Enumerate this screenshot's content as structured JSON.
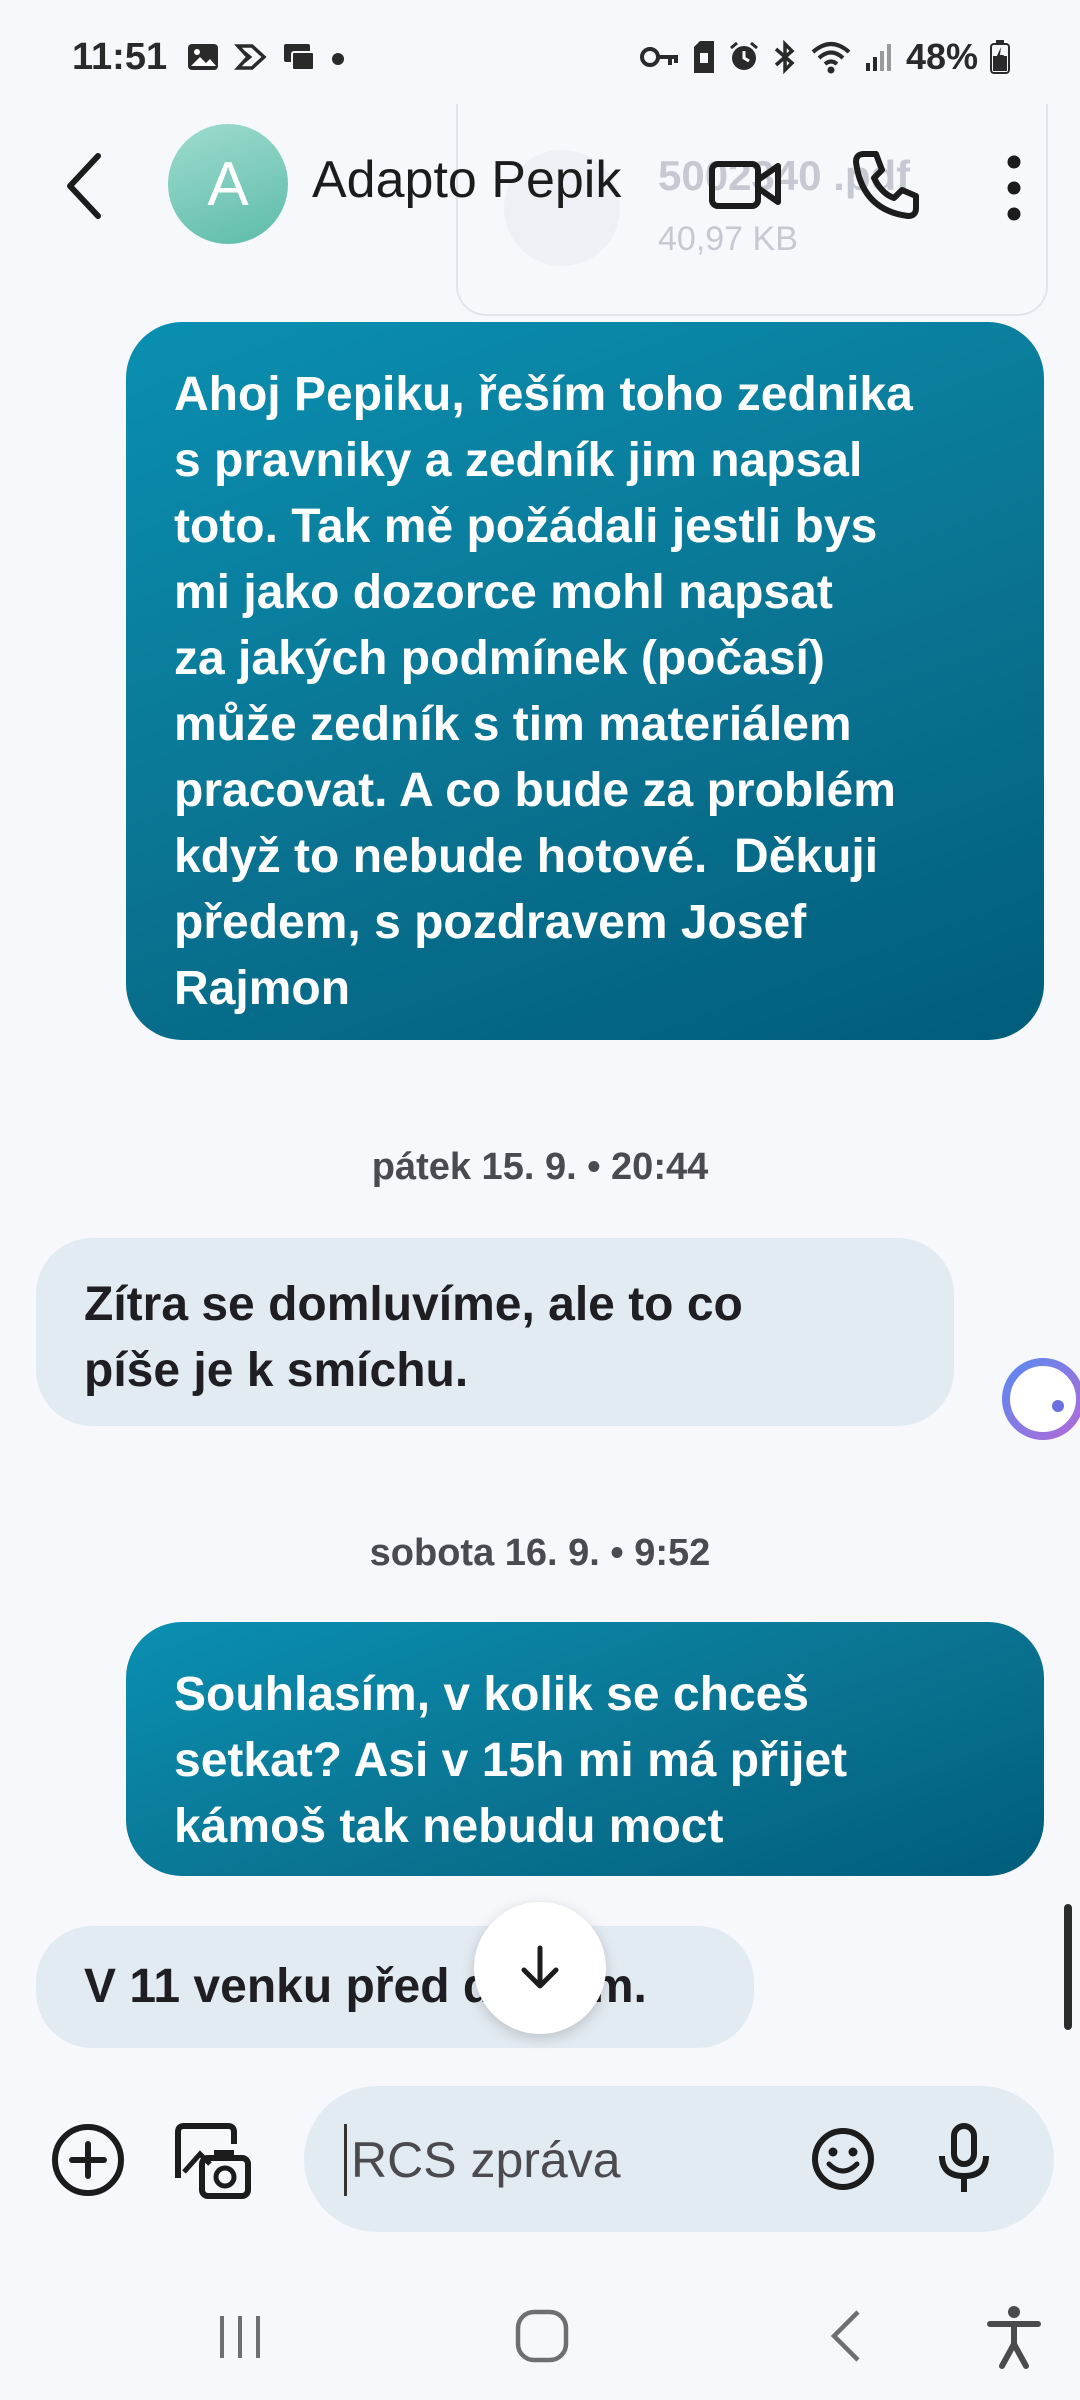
{
  "status_bar": {
    "time": "11:51",
    "battery": "48%",
    "left_icons": [
      "image-notification-icon",
      "app-notification-icon",
      "multi-window-icon",
      "dot-icon"
    ],
    "right_icons": [
      "key-icon",
      "sim-icon",
      "alarm-icon",
      "bluetooth-icon",
      "wifi-icon",
      "signal-icon",
      "battery-icon"
    ]
  },
  "header": {
    "avatar_letter": "A",
    "contact_name": "Adapto Pepik",
    "avatar_color": "#7cccbc"
  },
  "attachment": {
    "file_name": "5002340 .pdf",
    "file_size": "40,97 KB"
  },
  "messages": [
    {
      "direction": "out",
      "lines": [
        "Ahoj Pepiku, řeším toho zednika",
        "s pravniky a zedník jim napsal",
        "toto. Tak mě požádali jestli bys",
        "mi jako dozorce mohl napsat",
        "za jakých podmínek (počasí)",
        "může zedník s tim materiálem",
        "pracovat. A co bude za problém",
        "když to nebude hotové.  Děkuji",
        "předem, s pozdravem Josef",
        "Rajmon"
      ]
    },
    {
      "date_separator": "pátek 15. 9. • 20:44"
    },
    {
      "direction": "in",
      "lines": [
        "Zítra se domluvíme, ale to co",
        "píše je k smíchu."
      ]
    },
    {
      "date_separator": "sobota 16. 9. • 9:52"
    },
    {
      "direction": "out",
      "lines": [
        "Souhlasím, v kolik se chceš",
        "setkat? Asi v 15h mi má přijet",
        "kámoš tak nebudu moct"
      ]
    },
    {
      "direction": "in",
      "lines": [
        "V 11 venku před domem."
      ]
    }
  ],
  "composer": {
    "placeholder": "RCS zpráva"
  },
  "colors": {
    "outgoing_bubble": "#0a7c9c",
    "incoming_bubble": "#e3ebf2",
    "background": "#f7f8fc"
  }
}
